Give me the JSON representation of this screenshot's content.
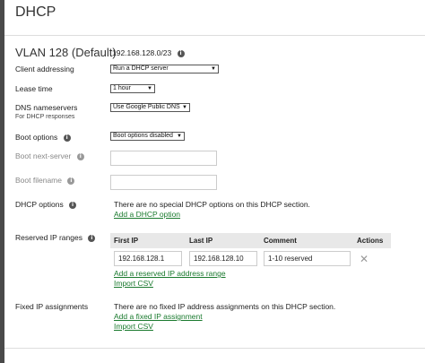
{
  "header": {
    "title": "DHCP"
  },
  "section": {
    "title": "VLAN 128 (Default)",
    "subnet": "192.168.128.0/23"
  },
  "client_addressing": {
    "label": "Client addressing",
    "value": "Run a DHCP server"
  },
  "lease_time": {
    "label": "Lease time",
    "value": "1 hour"
  },
  "dns": {
    "label": "DNS nameservers",
    "sublabel": "For DHCP responses",
    "value": "Use Google Public DNS"
  },
  "boot_options": {
    "label": "Boot options",
    "value": "Boot options disabled"
  },
  "boot_next_server": {
    "label": "Boot next-server",
    "value": ""
  },
  "boot_filename": {
    "label": "Boot filename",
    "value": ""
  },
  "dhcp_options": {
    "label": "DHCP options",
    "message": "There are no special DHCP options on this DHCP section.",
    "add_link": "Add a DHCP option"
  },
  "reserved": {
    "label": "Reserved IP ranges",
    "columns": [
      "First IP",
      "Last IP",
      "Comment",
      "Actions"
    ],
    "rows": [
      {
        "first_ip": "192.168.128.1",
        "last_ip": "192.168.128.10",
        "comment": "1-10 reserved"
      }
    ],
    "add_link": "Add a reserved IP address range",
    "import_link": "Import CSV"
  },
  "fixed": {
    "label": "Fixed IP assignments",
    "message": "There are no fixed IP address assignments on this DHCP section.",
    "add_link": "Add a fixed IP assignment",
    "import_link": "Import CSV"
  },
  "icons": {
    "info": "i",
    "dropdown": "▼",
    "remove": "✕"
  },
  "colors": {
    "link": "#1a7a2e",
    "sidebar": "#4a4a4a",
    "table_header": "#e8e8e8"
  }
}
